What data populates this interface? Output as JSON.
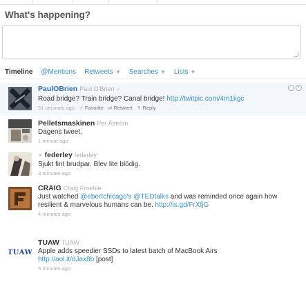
{
  "heading": "What's happening?",
  "tabs": [
    {
      "label": "Timeline",
      "active": true,
      "dropdown": false
    },
    {
      "label": "@Mentions",
      "active": false,
      "dropdown": false
    },
    {
      "label": "Retweets",
      "active": false,
      "dropdown": true
    },
    {
      "label": "Searches",
      "active": false,
      "dropdown": true
    },
    {
      "label": "Lists",
      "active": false,
      "dropdown": true
    }
  ],
  "tweets": [
    {
      "user": "PaulOBrien",
      "full_name": "Paul O'Brien",
      "text": "Road bridge? Train bridge? Canal bridge!",
      "link": "http://twitpic.com/4m1kgc",
      "time": "51 seconds ago",
      "actions": {
        "favorite": "Favorite",
        "retweet": "Retweet",
        "reply": "Reply"
      }
    },
    {
      "user": "Pelletsmaskinen",
      "full_name": "Per Åström",
      "text": "Dagens tweet.",
      "time": "1 minute ago"
    },
    {
      "user": "federley",
      "full_name": "federley",
      "text": "Sjukt fint brudpar. Blev lite blödig.",
      "time": "3 minutes ago"
    },
    {
      "user": "CRAIG",
      "full_name": "Craig Froehle",
      "text_prefix": "Just watched",
      "mention1": "@ebertchicago's",
      "mention2": "@TEDtalks",
      "text_rest": "and was reminded once again how resilient & marvelous humans can be.",
      "link": "http://is.gd/FrXfjG",
      "time": "4 minutes ago"
    },
    {
      "user": "TUAW",
      "full_name": "TUAW",
      "text": "Apple adds speedier SSDs to latest batch of MacBook Airs",
      "link": "http://aol.it/dJax8b",
      "suffix": "[post]",
      "time": "5 minutes ago",
      "avatar_label": "TUAW"
    }
  ],
  "colors": {
    "link": "#3a8fc2",
    "accent_bg": "#f3f7fb"
  }
}
